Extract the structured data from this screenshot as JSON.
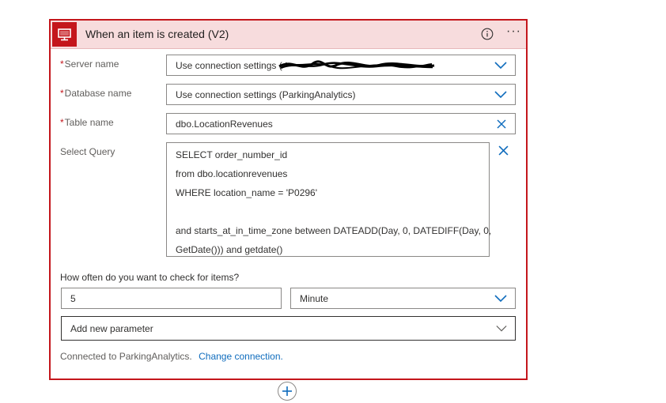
{
  "trigger": {
    "title": "When an item is created (V2)",
    "icon": "sql-server-icon",
    "accent_color": "#c4161c",
    "header_bg": "#f7dcdd"
  },
  "fields": {
    "server_name": {
      "label": "Server name",
      "value": "Use connection settings (",
      "required": true
    },
    "database_name": {
      "label": "Database name",
      "value": "Use connection settings (ParkingAnalytics)",
      "required": true
    },
    "table_name": {
      "label": "Table name",
      "value": "dbo.LocationRevenues",
      "required": true
    },
    "select_query": {
      "label": "Select Query",
      "lines": [
        "SELECT order_number_id",
        "from dbo.locationrevenues",
        "WHERE location_name = 'P0296'",
        "",
        "and  starts_at_in_time_zone between DATEADD(Day, 0, DATEDIFF(Day, 0,",
        "GetDate())) and getdate()"
      ]
    }
  },
  "recurrence": {
    "label": "How often do you want to check for items?",
    "interval": "5",
    "frequency": "Minute"
  },
  "add_parameter": {
    "placeholder": "Add new parameter"
  },
  "footer": {
    "connected_text": "Connected to ParkingAnalytics.",
    "change_link": "Change connection."
  }
}
